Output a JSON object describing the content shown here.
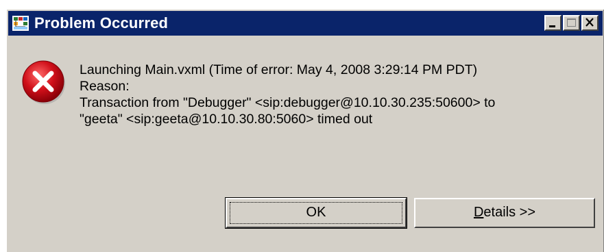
{
  "window": {
    "title": "Problem Occurred",
    "controls": {
      "minimize": "minimize",
      "maximize": "maximize",
      "close": "close"
    }
  },
  "message": {
    "lines": [
      "Launching Main.vxml (Time of error: May 4, 2008 3:29:14 PM PDT)",
      "Reason:",
      "Transaction from \"Debugger\" <sip:debugger@10.10.30.235:50600> to",
      "\"geeta\" <sip:geeta@10.10.30.80:5060> timed out"
    ]
  },
  "buttons": {
    "ok_label": "OK",
    "details_mnemonic": "D",
    "details_rest": "etails >>"
  },
  "colors": {
    "titlebar": "#0a246a",
    "face": "#d4d0c8",
    "error_red": "#d0101a"
  },
  "icons": {
    "app": "workflow-app-icon",
    "error": "error-x-icon"
  }
}
